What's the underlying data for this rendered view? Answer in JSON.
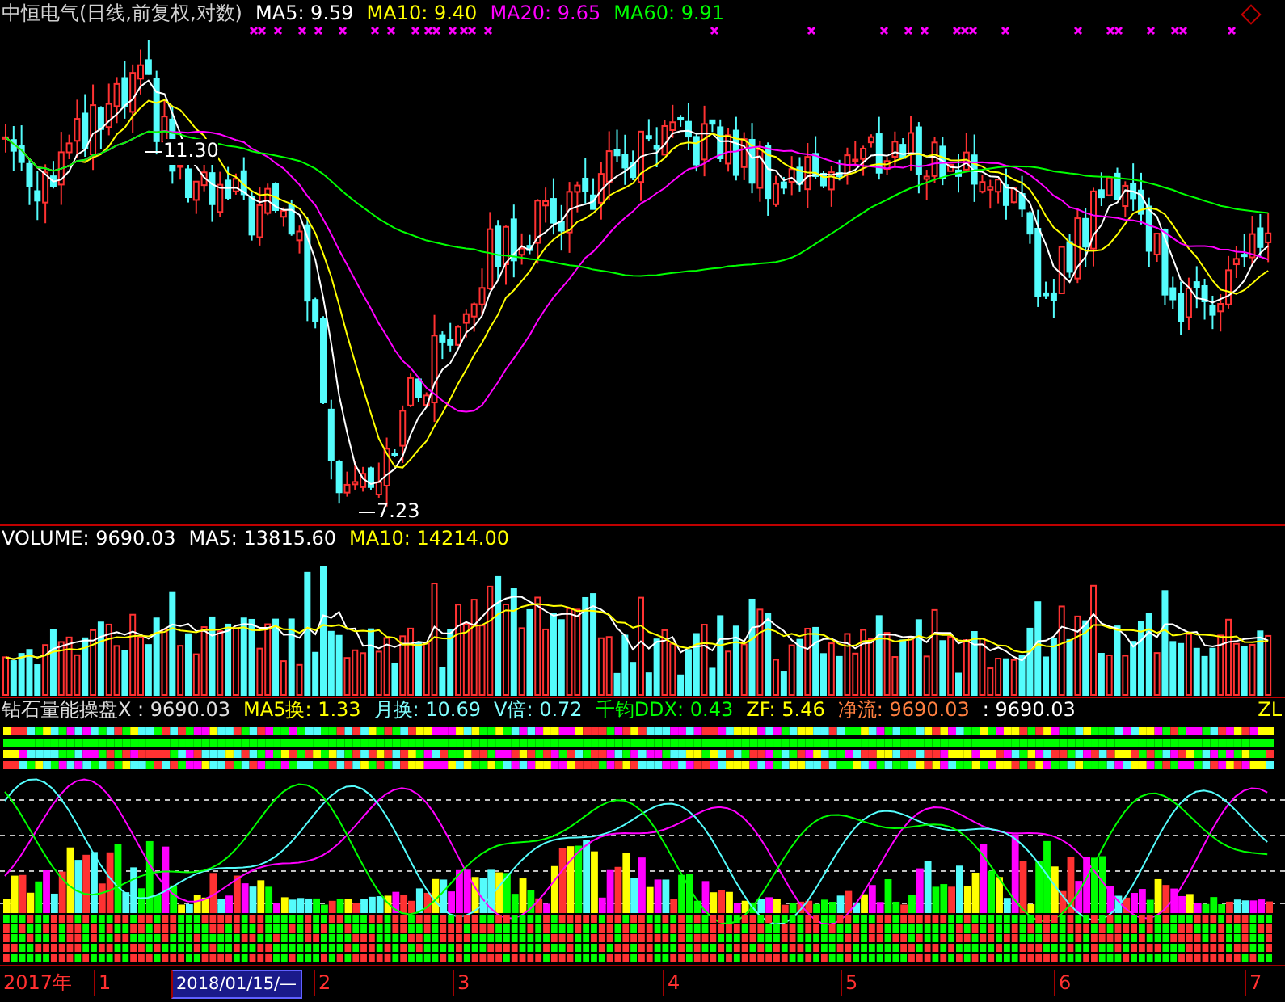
{
  "price_panel": {
    "title": "中恒电气(日线,前复权,对数)",
    "legend": [
      {
        "label": "MA5: 9.59",
        "color": "#ffffff"
      },
      {
        "label": "MA10: 9.40",
        "color": "#ffff00"
      },
      {
        "label": "MA20: 9.65",
        "color": "#ff00ff"
      },
      {
        "label": "MA60: 9.91",
        "color": "#00ff00"
      }
    ],
    "high_label": "11.30",
    "low_label": "7.23"
  },
  "volume_panel": {
    "legend": [
      {
        "label": "VOLUME: 9690.03",
        "color": "#ffffff"
      },
      {
        "label": "MA5: 13815.60",
        "color": "#ffffff"
      },
      {
        "label": "MA10: 14214.00",
        "color": "#ffff00"
      }
    ]
  },
  "indicator_panel": {
    "legend": [
      {
        "label": "钻石量能操盘X : 9690.03",
        "color": "#e0e0e0"
      },
      {
        "label": "MA5换: 1.33",
        "color": "#ffff00"
      },
      {
        "label": "月换: 10.69",
        "color": "#80ffff"
      },
      {
        "label": "V倍: 0.72",
        "color": "#80ffff"
      },
      {
        "label": "千钧DDX: 0.43",
        "color": "#00ff00"
      },
      {
        "label": "ZF: 5.46",
        "color": "#ffff00"
      },
      {
        "label": "净流: 9690.03",
        "color": "#ff8040"
      },
      {
        "label": ": 9690.03",
        "color": "#ffffff"
      }
    ],
    "corner_label": "ZL"
  },
  "time_axis": {
    "year": "2017年",
    "cursor_date": "2018/01/15/—",
    "months": [
      {
        "label": "1"
      },
      {
        "label": "2"
      },
      {
        "label": "3"
      },
      {
        "label": "4"
      },
      {
        "label": "5"
      },
      {
        "label": "6"
      },
      {
        "label": "7"
      }
    ]
  }
}
